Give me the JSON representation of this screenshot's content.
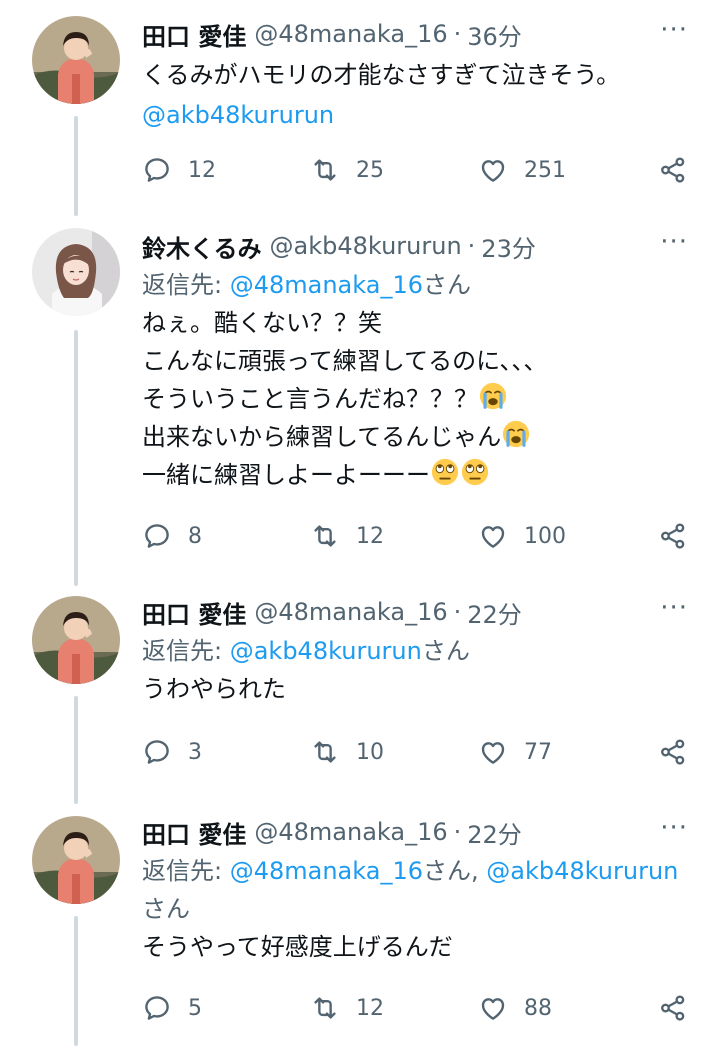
{
  "tweets": [
    {
      "name": "田口 愛佳",
      "handle": "@48manaka_16",
      "time": "36分",
      "text_plain": "くるみがハモリの才能なさすぎて泣きそう。",
      "text_link": "@akb48kururun",
      "replies": "12",
      "retweets": "25",
      "likes": "251"
    },
    {
      "name": "鈴木くるみ",
      "handle": "@akb48kururun",
      "time": "23分",
      "reply_prefix": "返信先: ",
      "reply_to": "@48manaka_16",
      "reply_suffix": "さん",
      "lines": [
        "ねぇ。酷くない？？笑",
        "こんなに頑張って練習してるのに、、、",
        "そういうこと言うんだね？？？",
        "出来ないから練習してるんじゃん",
        "一緒に練習しよーよーーー"
      ],
      "replies": "8",
      "retweets": "12",
      "likes": "100"
    },
    {
      "name": "田口 愛佳",
      "handle": "@48manaka_16",
      "time": "22分",
      "reply_prefix": "返信先: ",
      "reply_to": "@akb48kururun",
      "reply_suffix": "さん",
      "text": "うわやられた",
      "replies": "3",
      "retweets": "10",
      "likes": "77"
    },
    {
      "name": "田口 愛佳",
      "handle": "@48manaka_16",
      "time": "22分",
      "reply_prefix": "返信先: ",
      "reply_to_1": "@48manaka_16",
      "reply_mid": "さん, ",
      "reply_to_2": "@akb48kururun",
      "reply_suffix_line2": "さん",
      "text": "そうやって好感度上げるんだ",
      "replies": "5",
      "retweets": "12",
      "likes": "88"
    }
  ],
  "common": {
    "separator": "·",
    "more": "···"
  },
  "icons": [
    "more-icon",
    "reply-icon",
    "retweet-icon",
    "like-icon",
    "share-icon",
    "crying-emoji",
    "eye-roll-emoji"
  ],
  "colors": {
    "link": "#1d9bf0",
    "muted": "#536471",
    "text": "#0f1419",
    "thread_line": "#cfd9de"
  }
}
